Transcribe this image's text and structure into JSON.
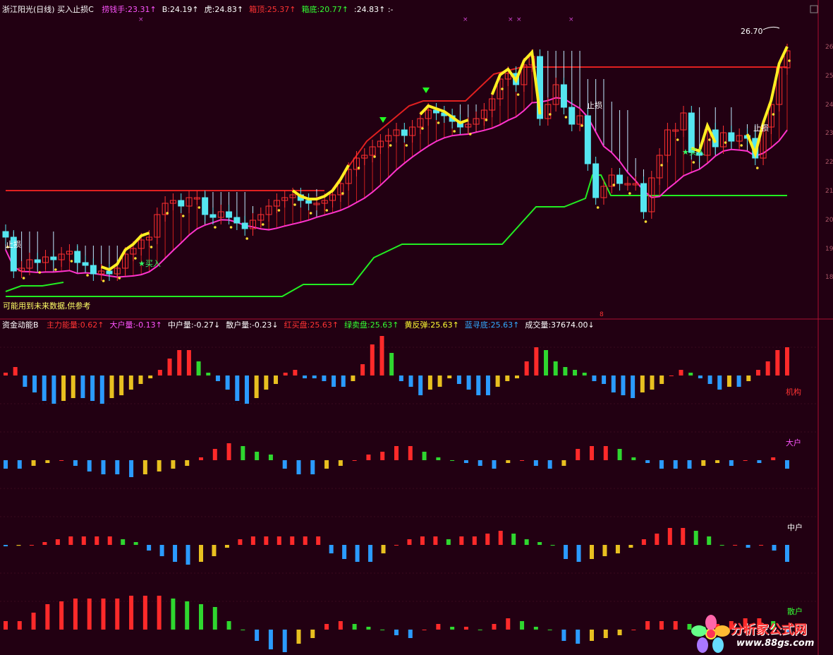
{
  "top_header": {
    "title": "浙江阳光(日线) 买入止损C",
    "items": [
      {
        "label": "捞钱手:",
        "value": "23.31",
        "arrow": "↑",
        "color": "#ff55ff"
      },
      {
        "label": "B:",
        "value": "24.19",
        "arrow": "↑",
        "color": "#ffffff"
      },
      {
        "label": "虎:",
        "value": "24.83",
        "arrow": "↑",
        "color": "#ffffff"
      },
      {
        "label": "箱顶:",
        "value": "25.37",
        "arrow": "↑",
        "color": "#ff3333"
      },
      {
        "label": "箱底:",
        "value": "20.77",
        "arrow": "↑",
        "color": "#33ff33"
      },
      {
        "label": ":",
        "value": "24.83",
        "arrow": "↑",
        "color": "#ffffff"
      }
    ],
    "extra_dashes": ":-"
  },
  "price_panel": {
    "last_price_label": "26.70",
    "annotations": {
      "stop_loss_1": "止损",
      "stop_loss_2": "止损",
      "stop_loss_3": "止损",
      "buy_1": "买入",
      "buy_2": "买入"
    },
    "footnote": "可能用到未来数据,供参考",
    "y_axis_labels": [
      "26",
      "25",
      "24",
      "23",
      "22",
      "21",
      "20",
      "19",
      "18"
    ]
  },
  "bottom_header": {
    "title": "资金动能B",
    "items": [
      {
        "label": "主力能量:",
        "value": "0.62",
        "arrow": "↑",
        "color": "#ff3333"
      },
      {
        "label": "大户量:",
        "value": "-0.13",
        "arrow": "↑",
        "color": "#ff55ff"
      },
      {
        "label": "中户量:",
        "value": "-0.27",
        "arrow": "↓",
        "color": "#ffffff"
      },
      {
        "label": "散户量:",
        "value": "-0.23",
        "arrow": "↓",
        "color": "#ffffff"
      },
      {
        "label": "红买盘:",
        "value": "25.63",
        "arrow": "↑",
        "color": "#ff3333"
      },
      {
        "label": "绿卖盘:",
        "value": "25.63",
        "arrow": "↑",
        "color": "#33ff33"
      },
      {
        "label": "黄反弹:",
        "value": "25.63",
        "arrow": "↑",
        "color": "#ffff33"
      },
      {
        "label": "蓝寻底:",
        "value": "25.63",
        "arrow": "↑",
        "color": "#33aaff"
      },
      {
        "label": "成交量:",
        "value": "37674.00",
        "arrow": "↓",
        "color": "#ffffff"
      }
    ]
  },
  "panel_labels": {
    "jigou": "机构",
    "dahu": "大户",
    "zhonghu": "中户",
    "sanhu": "散户"
  },
  "watermark": {
    "text": "分析家公式网",
    "url": "www.88gs.com"
  },
  "colors": {
    "red": "#ff2a2a",
    "green": "#2fd72f",
    "yellow": "#e8c020",
    "blue": "#2b9bff",
    "cyan": "#55e6f0",
    "magenta": "#ff33cc",
    "thickline": "#ffee22"
  },
  "chart_data": {
    "type": "bar",
    "price_ylim": [
      17.5,
      27
    ],
    "candles_close": [
      19.6,
      18.4,
      18.5,
      18.8,
      18.7,
      18.9,
      18.8,
      19.0,
      19.1,
      18.7,
      18.6,
      18.3,
      18.4,
      18.3,
      18.5,
      19.0,
      19.2,
      19.5,
      19.6,
      20.4,
      20.8,
      20.9,
      20.7,
      21.0,
      21.0,
      20.4,
      20.3,
      20.5,
      20.3,
      20.1,
      19.9,
      20.2,
      20.4,
      20.7,
      20.9,
      21.0,
      21.1,
      20.9,
      20.8,
      20.8,
      20.9,
      21.1,
      21.5,
      22.0,
      22.4,
      22.5,
      22.8,
      23.0,
      23.2,
      23.4,
      23.2,
      23.5,
      23.8,
      24.1,
      24.0,
      23.9,
      23.7,
      23.5,
      23.6,
      23.8,
      24.1,
      24.5,
      25.2,
      25.4,
      25.0,
      25.7,
      26.0,
      23.8,
      24.3,
      25.0,
      24.2,
      23.6,
      23.9,
      22.2,
      21.0,
      21.4,
      21.8,
      21.5,
      21.5,
      21.5,
      20.5,
      21.7,
      22.5,
      23.4,
      23.4,
      24.0,
      22.6,
      22.5,
      23.4,
      22.8,
      23.3,
      23.0,
      23.2,
      23.1,
      22.4,
      23.5,
      24.3,
      25.6,
      26.2
    ],
    "series": [
      {
        "name": "机构",
        "values": [
          0.1,
          0.3,
          -0.4,
          -0.6,
          -0.9,
          -1.0,
          -0.9,
          -0.8,
          -0.8,
          -0.9,
          -1.0,
          -0.8,
          -0.7,
          -0.5,
          -0.3,
          -0.1,
          0.2,
          0.6,
          0.9,
          0.9,
          0.5,
          0.1,
          -0.2,
          -0.5,
          -0.9,
          -1.0,
          -0.8,
          -0.5,
          -0.3,
          0.1,
          0.2,
          -0.1,
          -0.1,
          -0.2,
          -0.4,
          -0.4,
          -0.2,
          0.4,
          1.1,
          1.4,
          0.8,
          -0.2,
          -0.4,
          -0.7,
          -0.5,
          -0.4,
          -0.1,
          -0.3,
          -0.5,
          -0.7,
          -0.7,
          -0.4,
          -0.2,
          -0.1,
          0.5,
          1.0,
          0.9,
          0.5,
          0.3,
          0.2,
          0.1,
          -0.2,
          -0.3,
          -0.6,
          -0.7,
          -0.8,
          -0.6,
          -0.5,
          -0.3,
          0.0,
          0.2,
          0.1,
          -0.1,
          -0.3,
          -0.5,
          -0.4,
          -0.4,
          -0.2,
          0.2,
          0.5,
          0.9,
          1.0
        ]
      },
      {
        "name": "大户",
        "values": [
          -0.3,
          -0.3,
          -0.2,
          -0.1,
          0.0,
          -0.2,
          -0.4,
          -0.5,
          -0.5,
          -0.6,
          -0.5,
          -0.4,
          -0.3,
          -0.2,
          0.1,
          0.4,
          0.6,
          0.5,
          0.3,
          0.2,
          -0.3,
          -0.5,
          -0.5,
          -0.3,
          -0.2,
          0.0,
          0.2,
          0.3,
          0.5,
          0.5,
          0.3,
          0.1,
          0.0,
          -0.1,
          -0.2,
          -0.3,
          -0.1,
          0.0,
          -0.2,
          -0.3,
          -0.2,
          0.4,
          0.5,
          0.5,
          0.4,
          0.1,
          -0.1,
          -0.3,
          -0.3,
          -0.3,
          -0.2,
          -0.1,
          -0.2,
          0.0,
          -0.1,
          0.1,
          -0.3
        ]
      },
      {
        "name": "中户",
        "values": [
          -0.05,
          -0.03,
          0.0,
          0.1,
          0.2,
          0.3,
          0.3,
          0.3,
          0.3,
          0.2,
          0.1,
          -0.2,
          -0.4,
          -0.6,
          -0.7,
          -0.6,
          -0.4,
          -0.1,
          0.2,
          0.3,
          0.3,
          0.3,
          0.3,
          0.3,
          0.3,
          -0.3,
          -0.5,
          -0.6,
          -0.6,
          -0.3,
          0.0,
          0.2,
          0.3,
          0.3,
          0.2,
          0.3,
          0.3,
          0.4,
          0.5,
          0.4,
          0.2,
          0.1,
          0.0,
          -0.5,
          -0.6,
          -0.5,
          -0.4,
          -0.3,
          -0.1,
          0.2,
          0.4,
          0.6,
          0.6,
          0.5,
          0.3,
          0.0,
          0.0,
          -0.1,
          0.0,
          -0.2,
          -0.6
        ]
      },
      {
        "name": "散户",
        "values": [
          0.3,
          0.3,
          0.6,
          0.9,
          1.0,
          1.1,
          1.1,
          1.1,
          1.1,
          1.2,
          1.2,
          1.2,
          1.1,
          1.0,
          0.9,
          0.8,
          0.3,
          0.0,
          -0.4,
          -0.7,
          -0.8,
          -0.5,
          -0.3,
          0.2,
          0.3,
          0.2,
          0.1,
          0.0,
          -0.2,
          -0.3,
          0.0,
          0.2,
          0.1,
          0.1,
          0.0,
          0.2,
          0.4,
          0.3,
          0.1,
          0.0,
          -0.4,
          -0.5,
          -0.4,
          -0.3,
          -0.2,
          0.0,
          0.3,
          0.3,
          0.3,
          0.2,
          0.1,
          0.2,
          0.3,
          0.4,
          0.4,
          0.3,
          -0.1
        ]
      }
    ]
  }
}
